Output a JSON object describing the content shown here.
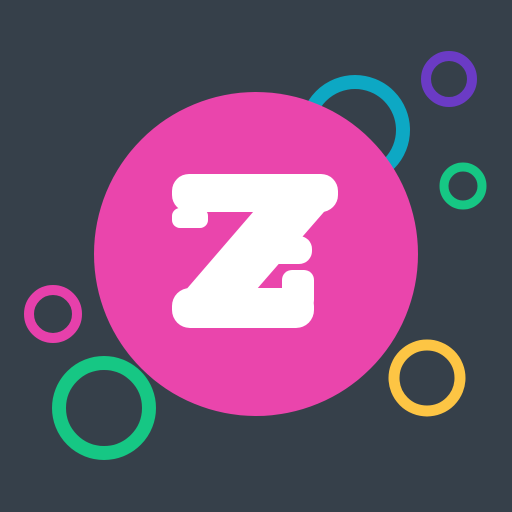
{
  "app_icon": {
    "logo_letter": "Z",
    "logo_shape": "z-logo-icon"
  },
  "colors": {
    "background": "#36404a",
    "badge": "#ea45ac",
    "logo": "#ffffff",
    "ring_teal": "#0da8c4",
    "ring_purple": "#6b3bc5",
    "ring_green": "#16c784",
    "ring_magenta": "#e640ab",
    "ring_yellow": "#fdc544"
  }
}
